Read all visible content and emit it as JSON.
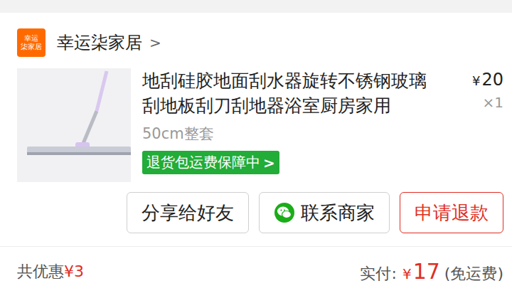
{
  "store": {
    "logo_lines": [
      "幸运",
      "柒家居"
    ],
    "name": "幸运柒家居",
    "chevron": ">"
  },
  "product": {
    "title": "地刮硅胶地面刮水器旋转不锈钢玻璃刮地板刮刀刮地器浴室厨房家用",
    "spec": "50cm整套",
    "price_currency": "¥",
    "price": "20",
    "quantity": "×1",
    "badge": "退货包运费保障中",
    "badge_chevron": ">"
  },
  "buttons": [
    {
      "label": "分享给好友",
      "kind": "plain"
    },
    {
      "label": "联系商家",
      "kind": "contact"
    },
    {
      "label": "申请退款",
      "kind": "refund"
    }
  ],
  "summary": {
    "discount_label": "共优惠",
    "discount": "¥3",
    "paid_label": "实付:",
    "paid_currency": "¥",
    "paid_amount": "17",
    "paid_note": "(免运费)"
  }
}
